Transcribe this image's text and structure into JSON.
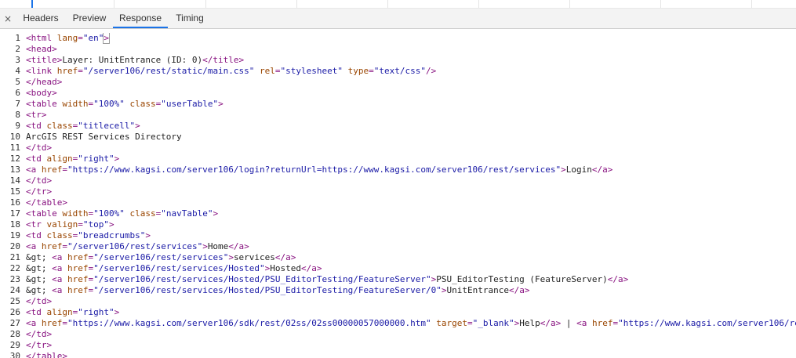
{
  "tabs": {
    "close_glyph": "×",
    "headers": "Headers",
    "preview": "Preview",
    "response": "Response",
    "timing": "Timing",
    "active": "Response"
  },
  "colors": {
    "tag": "#881280",
    "attribute": "#994500",
    "value": "#1a1aa6",
    "text": "#222222",
    "active_tab_underline": "#1a73e8"
  },
  "source_lines": [
    {
      "n": "1",
      "tokens": [
        [
          "tag",
          "<html "
        ],
        [
          "attr",
          "lang"
        ],
        [
          "op",
          "="
        ],
        [
          "val",
          "\"en\""
        ],
        [
          "tag",
          ">"
        ]
      ]
    },
    {
      "n": "2",
      "tokens": [
        [
          "tag",
          "<head>"
        ]
      ]
    },
    {
      "n": "3",
      "tokens": [
        [
          "tag",
          "<title>"
        ],
        [
          "txt",
          "Layer: UnitEntrance (ID: 0)"
        ],
        [
          "tag",
          "</title>"
        ]
      ]
    },
    {
      "n": "4",
      "tokens": [
        [
          "tag",
          "<link "
        ],
        [
          "attr",
          "href"
        ],
        [
          "op",
          "="
        ],
        [
          "val",
          "\"/server106/rest/static/main.css\""
        ],
        [
          "txt",
          " "
        ],
        [
          "attr",
          "rel"
        ],
        [
          "op",
          "="
        ],
        [
          "val",
          "\"stylesheet\""
        ],
        [
          "txt",
          " "
        ],
        [
          "attr",
          "type"
        ],
        [
          "op",
          "="
        ],
        [
          "val",
          "\"text/css\""
        ],
        [
          "tag",
          "/>"
        ]
      ]
    },
    {
      "n": "5",
      "tokens": [
        [
          "tag",
          "</head>"
        ]
      ]
    },
    {
      "n": "6",
      "tokens": [
        [
          "tag",
          "<body>"
        ]
      ]
    },
    {
      "n": "7",
      "tokens": [
        [
          "tag",
          "<table "
        ],
        [
          "attr",
          "width"
        ],
        [
          "op",
          "="
        ],
        [
          "val",
          "\"100%\""
        ],
        [
          "txt",
          " "
        ],
        [
          "attr",
          "class"
        ],
        [
          "op",
          "="
        ],
        [
          "val",
          "\"userTable\""
        ],
        [
          "tag",
          ">"
        ]
      ]
    },
    {
      "n": "8",
      "tokens": [
        [
          "tag",
          "<tr>"
        ]
      ]
    },
    {
      "n": "9",
      "tokens": [
        [
          "tag",
          "<td "
        ],
        [
          "attr",
          "class"
        ],
        [
          "op",
          "="
        ],
        [
          "val",
          "\"titlecell\""
        ],
        [
          "tag",
          ">"
        ]
      ]
    },
    {
      "n": "10",
      "tokens": [
        [
          "txt",
          "ArcGIS REST Services Directory"
        ]
      ]
    },
    {
      "n": "11",
      "tokens": [
        [
          "tag",
          "</td>"
        ]
      ]
    },
    {
      "n": "12",
      "tokens": [
        [
          "tag",
          "<td "
        ],
        [
          "attr",
          "align"
        ],
        [
          "op",
          "="
        ],
        [
          "val",
          "\"right\""
        ],
        [
          "tag",
          ">"
        ]
      ]
    },
    {
      "n": "13",
      "tokens": [
        [
          "tag",
          "<a "
        ],
        [
          "attr",
          "href"
        ],
        [
          "op",
          "="
        ],
        [
          "val",
          "\"https://www.kagsi.com/server106/login?returnUrl=https://www.kagsi.com/server106/rest/services\""
        ],
        [
          "tag",
          ">"
        ],
        [
          "txt",
          "Login"
        ],
        [
          "tag",
          "</a>"
        ]
      ]
    },
    {
      "n": "14",
      "tokens": [
        [
          "tag",
          "</td>"
        ]
      ]
    },
    {
      "n": "15",
      "tokens": [
        [
          "tag",
          "</tr>"
        ]
      ]
    },
    {
      "n": "16",
      "tokens": [
        [
          "tag",
          "</table>"
        ]
      ]
    },
    {
      "n": "17",
      "tokens": [
        [
          "tag",
          "<table "
        ],
        [
          "attr",
          "width"
        ],
        [
          "op",
          "="
        ],
        [
          "val",
          "\"100%\""
        ],
        [
          "txt",
          " "
        ],
        [
          "attr",
          "class"
        ],
        [
          "op",
          "="
        ],
        [
          "val",
          "\"navTable\""
        ],
        [
          "tag",
          ">"
        ]
      ]
    },
    {
      "n": "18",
      "tokens": [
        [
          "tag",
          "<tr "
        ],
        [
          "attr",
          "valign"
        ],
        [
          "op",
          "="
        ],
        [
          "val",
          "\"top\""
        ],
        [
          "tag",
          ">"
        ]
      ]
    },
    {
      "n": "19",
      "tokens": [
        [
          "tag",
          "<td "
        ],
        [
          "attr",
          "class"
        ],
        [
          "op",
          "="
        ],
        [
          "val",
          "\"breadcrumbs\""
        ],
        [
          "tag",
          ">"
        ]
      ]
    },
    {
      "n": "20",
      "tokens": [
        [
          "tag",
          "<a "
        ],
        [
          "attr",
          "href"
        ],
        [
          "op",
          "="
        ],
        [
          "val",
          "\"/server106/rest/services\""
        ],
        [
          "tag",
          ">"
        ],
        [
          "txt",
          "Home"
        ],
        [
          "tag",
          "</a>"
        ]
      ]
    },
    {
      "n": "21",
      "tokens": [
        [
          "txt",
          "&gt; "
        ],
        [
          "tag",
          "<a "
        ],
        [
          "attr",
          "href"
        ],
        [
          "op",
          "="
        ],
        [
          "val",
          "\"/server106/rest/services\""
        ],
        [
          "tag",
          ">"
        ],
        [
          "txt",
          "services"
        ],
        [
          "tag",
          "</a>"
        ]
      ]
    },
    {
      "n": "22",
      "tokens": [
        [
          "txt",
          "&gt; "
        ],
        [
          "tag",
          "<a "
        ],
        [
          "attr",
          "href"
        ],
        [
          "op",
          "="
        ],
        [
          "val",
          "\"/server106/rest/services/Hosted\""
        ],
        [
          "tag",
          ">"
        ],
        [
          "txt",
          "Hosted"
        ],
        [
          "tag",
          "</a>"
        ]
      ]
    },
    {
      "n": "23",
      "tokens": [
        [
          "txt",
          "&gt; "
        ],
        [
          "tag",
          "<a "
        ],
        [
          "attr",
          "href"
        ],
        [
          "op",
          "="
        ],
        [
          "val",
          "\"/server106/rest/services/Hosted/PSU_EditorTesting/FeatureServer\""
        ],
        [
          "tag",
          ">"
        ],
        [
          "txt",
          "PSU_EditorTesting (FeatureServer)"
        ],
        [
          "tag",
          "</a>"
        ]
      ]
    },
    {
      "n": "24",
      "tokens": [
        [
          "txt",
          "&gt; "
        ],
        [
          "tag",
          "<a "
        ],
        [
          "attr",
          "href"
        ],
        [
          "op",
          "="
        ],
        [
          "val",
          "\"/server106/rest/services/Hosted/PSU_EditorTesting/FeatureServer/0\""
        ],
        [
          "tag",
          ">"
        ],
        [
          "txt",
          "UnitEntrance"
        ],
        [
          "tag",
          "</a>"
        ]
      ]
    },
    {
      "n": "25",
      "tokens": [
        [
          "tag",
          "</td>"
        ]
      ]
    },
    {
      "n": "26",
      "tokens": [
        [
          "tag",
          "<td "
        ],
        [
          "attr",
          "align"
        ],
        [
          "op",
          "="
        ],
        [
          "val",
          "\"right\""
        ],
        [
          "tag",
          ">"
        ]
      ]
    },
    {
      "n": "27",
      "tokens": [
        [
          "tag",
          "<a "
        ],
        [
          "attr",
          "href"
        ],
        [
          "op",
          "="
        ],
        [
          "val",
          "\"https://www.kagsi.com/server106/sdk/rest/02ss/02ss00000057000000.htm\""
        ],
        [
          "txt",
          " "
        ],
        [
          "attr",
          "target"
        ],
        [
          "op",
          "="
        ],
        [
          "val",
          "\"_blank\""
        ],
        [
          "tag",
          ">"
        ],
        [
          "txt",
          "Help"
        ],
        [
          "tag",
          "</a>"
        ],
        [
          "txt",
          " | "
        ],
        [
          "tag",
          "<a "
        ],
        [
          "attr",
          "href"
        ],
        [
          "op",
          "="
        ],
        [
          "val",
          "\"https://www.kagsi.com/server106/re"
        ]
      ]
    },
    {
      "n": "28",
      "tokens": [
        [
          "tag",
          "</td>"
        ]
      ]
    },
    {
      "n": "29",
      "tokens": [
        [
          "tag",
          "</tr>"
        ]
      ]
    },
    {
      "n": "30",
      "tokens": [
        [
          "tag",
          "</table>"
        ]
      ]
    }
  ]
}
